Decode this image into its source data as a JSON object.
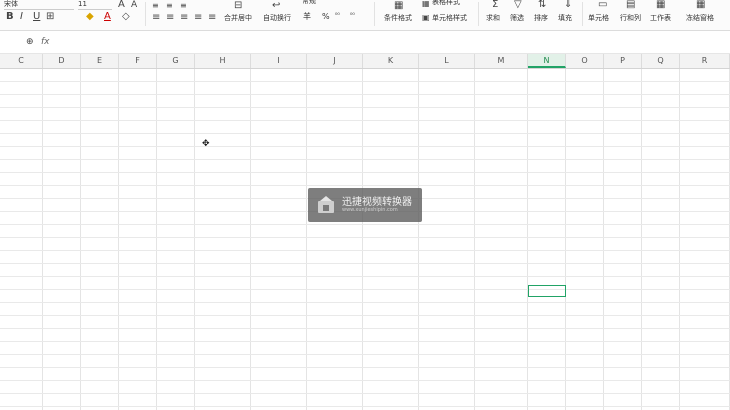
{
  "toolbar": {
    "font_name": "宋体",
    "font_size": "11",
    "font_size_up_icon": "A",
    "font_size_down_icon": "A",
    "bold": "B",
    "italic": "I",
    "underline": "U",
    "font_color_icon": "A",
    "merge_center": "合并居中",
    "wrap_text": "自动换行",
    "number_format": "常规",
    "currency": "羊",
    "percent": "%",
    "conditional_format": "条件格式",
    "table_style": "表格样式",
    "cell_style": "单元格样式",
    "sum": "求和",
    "filter": "筛选",
    "sort": "排序",
    "fill": "填充",
    "cell": "单元格",
    "row_col": "行和列",
    "worksheet": "工作表",
    "freeze": "冻结窗格"
  },
  "formula_bar": {
    "zoom_icon": "⊕",
    "fx_label": "fx"
  },
  "columns": [
    "C",
    "D",
    "E",
    "F",
    "G",
    "H",
    "I",
    "J",
    "K",
    "L",
    "M",
    "N",
    "O",
    "P",
    "Q",
    "R"
  ],
  "active_column": "N",
  "watermark": {
    "title": "迅捷视频转换器",
    "subtitle": "www.xunjieshipin.com"
  },
  "colors": {
    "accent": "#21a366",
    "grid": "#e4e4e4"
  }
}
